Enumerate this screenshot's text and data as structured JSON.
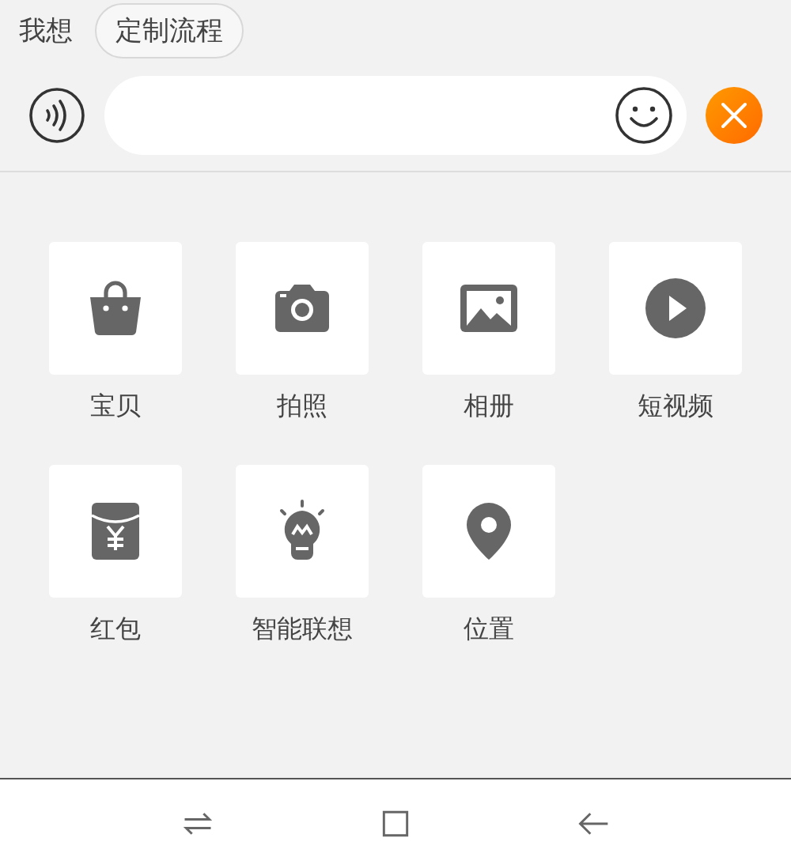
{
  "prompt_label": "我想",
  "chips": [
    {
      "label": "定制流程"
    }
  ],
  "items": [
    {
      "kind": "bag",
      "label": "宝贝"
    },
    {
      "kind": "camera",
      "label": "拍照"
    },
    {
      "kind": "album",
      "label": "相册"
    },
    {
      "kind": "video",
      "label": "短视频"
    },
    {
      "kind": "redpacket",
      "label": "红包"
    },
    {
      "kind": "bulb",
      "label": "智能联想"
    },
    {
      "kind": "location",
      "label": "位置"
    }
  ]
}
